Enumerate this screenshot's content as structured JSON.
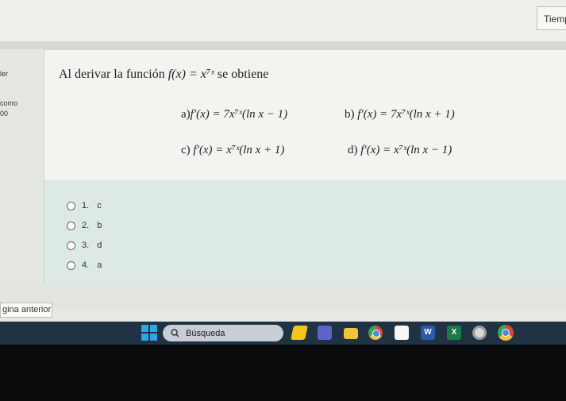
{
  "timer": {
    "label": "Tiemp"
  },
  "left_panel": {
    "fragment1": "ler",
    "fragment2": "como",
    "fragment3": "00"
  },
  "question": {
    "intro": "Al derivar la función",
    "function": "f(x) = x⁷ˣ",
    "outro": "se obtiene",
    "options": [
      {
        "label": "a)",
        "expr": "f′(x) = 7x⁷ˣ(ln x − 1)"
      },
      {
        "label": "b)",
        "expr": "f′(x) = 7x⁷ˣ(ln x + 1)"
      },
      {
        "label": "c)",
        "expr": "f′(x) = x⁷ˣ(ln x + 1)"
      },
      {
        "label": "d)",
        "expr": "f′(x) = x⁷ˣ(ln x − 1)"
      }
    ]
  },
  "answers": [
    {
      "num": "1.",
      "label": "c"
    },
    {
      "num": "2.",
      "label": "b"
    },
    {
      "num": "3.",
      "label": "d"
    },
    {
      "num": "4.",
      "label": "a"
    }
  ],
  "navigation": {
    "previous_page": "gina anterior"
  },
  "taskbar": {
    "search_label": "Búsqueda",
    "icons": [
      "windows-start-icon",
      "search-icon",
      "app-icon",
      "video-call-icon",
      "file-explorer-icon",
      "chrome-icon",
      "store-icon",
      "word-icon",
      "excel-icon",
      "settings-icon",
      "chrome-icon"
    ],
    "word_letter": "W",
    "excel_letter": "X"
  }
}
